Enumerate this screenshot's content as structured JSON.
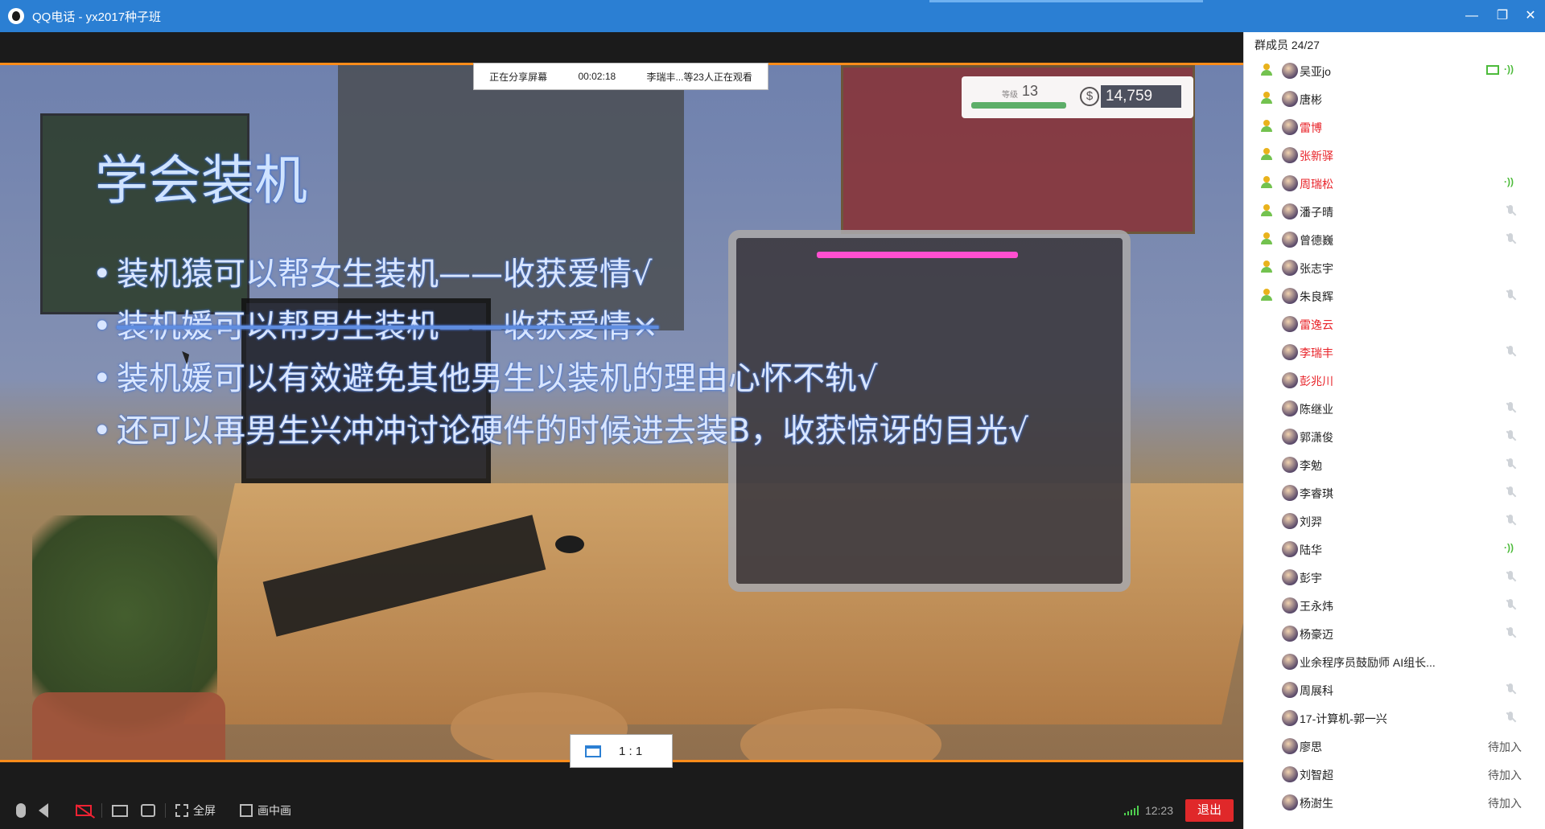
{
  "window": {
    "title": "QQ电话 - yx2017种子班",
    "minimize_icon": "minimize-icon",
    "restore_icon": "restore-icon",
    "close_icon": "close-icon"
  },
  "share_bar": {
    "status": "正在分享屏幕",
    "timer": "00:02:18",
    "viewers": "李瑞丰...等23人正在观看"
  },
  "shared_screen": {
    "slide_title": "学会装机",
    "bullets": [
      "装机猿可以帮女生装机——收获爱情√",
      "装机媛可以帮男生装机——收获爱情×",
      "装机媛可以有效避免其他男生以装机的理由心怀不轨√",
      "还可以再男生兴冲冲讨论硬件的时候进去装B，收获惊讶的目光√"
    ],
    "hud": {
      "level_label": "等级",
      "level": "13",
      "money_symbol": "$",
      "money": "14,759"
    },
    "ratio_label": "1 : 1"
  },
  "toolbar": {
    "fullscreen_label": "全屏",
    "pip_label": "画中画",
    "time": "12:23",
    "exit_label": "退出"
  },
  "panel": {
    "title": "群成员 24/27",
    "members": [
      {
        "name": "吴亚jo",
        "admin": true,
        "red": false,
        "state": "screen-speak"
      },
      {
        "name": "唐彬",
        "admin": true,
        "red": false,
        "state": ""
      },
      {
        "name": "雷博",
        "admin": true,
        "red": true,
        "state": ""
      },
      {
        "name": "张新驿",
        "admin": true,
        "red": true,
        "state": ""
      },
      {
        "name": "周瑞松",
        "admin": true,
        "red": true,
        "state": "speak"
      },
      {
        "name": "潘子晴",
        "admin": true,
        "red": false,
        "state": "mute"
      },
      {
        "name": "曾德巍",
        "admin": true,
        "red": false,
        "state": "mute"
      },
      {
        "name": "张志宇",
        "admin": true,
        "red": false,
        "state": ""
      },
      {
        "name": "朱良辉",
        "admin": true,
        "red": false,
        "state": "mute"
      },
      {
        "name": "雷逸云",
        "admin": false,
        "red": true,
        "state": ""
      },
      {
        "name": "李瑞丰",
        "admin": false,
        "red": true,
        "state": "mute"
      },
      {
        "name": "彭兆川",
        "admin": false,
        "red": true,
        "state": ""
      },
      {
        "name": "陈继业",
        "admin": false,
        "red": false,
        "state": "mute"
      },
      {
        "name": "郭潇俊",
        "admin": false,
        "red": false,
        "state": "mute"
      },
      {
        "name": "李勉",
        "admin": false,
        "red": false,
        "state": "mute"
      },
      {
        "name": "李睿琪",
        "admin": false,
        "red": false,
        "state": "mute"
      },
      {
        "name": "刘羿",
        "admin": false,
        "red": false,
        "state": "mute"
      },
      {
        "name": "陆华",
        "admin": false,
        "red": false,
        "state": "speak"
      },
      {
        "name": "彭宇",
        "admin": false,
        "red": false,
        "state": "mute"
      },
      {
        "name": "王永炜",
        "admin": false,
        "red": false,
        "state": "mute"
      },
      {
        "name": "杨豪迈",
        "admin": false,
        "red": false,
        "state": "mute"
      },
      {
        "name": "业余程序员鼓励师 AI组长...",
        "admin": false,
        "red": false,
        "state": ""
      },
      {
        "name": "周展科",
        "admin": false,
        "red": false,
        "state": "mute"
      },
      {
        "name": "17-计算机-郭一兴",
        "admin": false,
        "red": false,
        "state": "mute"
      },
      {
        "name": "廖思",
        "admin": false,
        "red": false,
        "state": "pending"
      },
      {
        "name": "刘智超",
        "admin": false,
        "red": false,
        "state": "pending"
      },
      {
        "name": "杨澍生",
        "admin": false,
        "red": false,
        "state": "pending"
      }
    ],
    "pending_label": "待加入"
  },
  "colors": {
    "title_bar": "#2b7fd3",
    "share_border": "#ff8c1a",
    "exit_button": "#e0282a",
    "highlight_name": "#e8242a",
    "speaking": "#4dbb3b"
  }
}
